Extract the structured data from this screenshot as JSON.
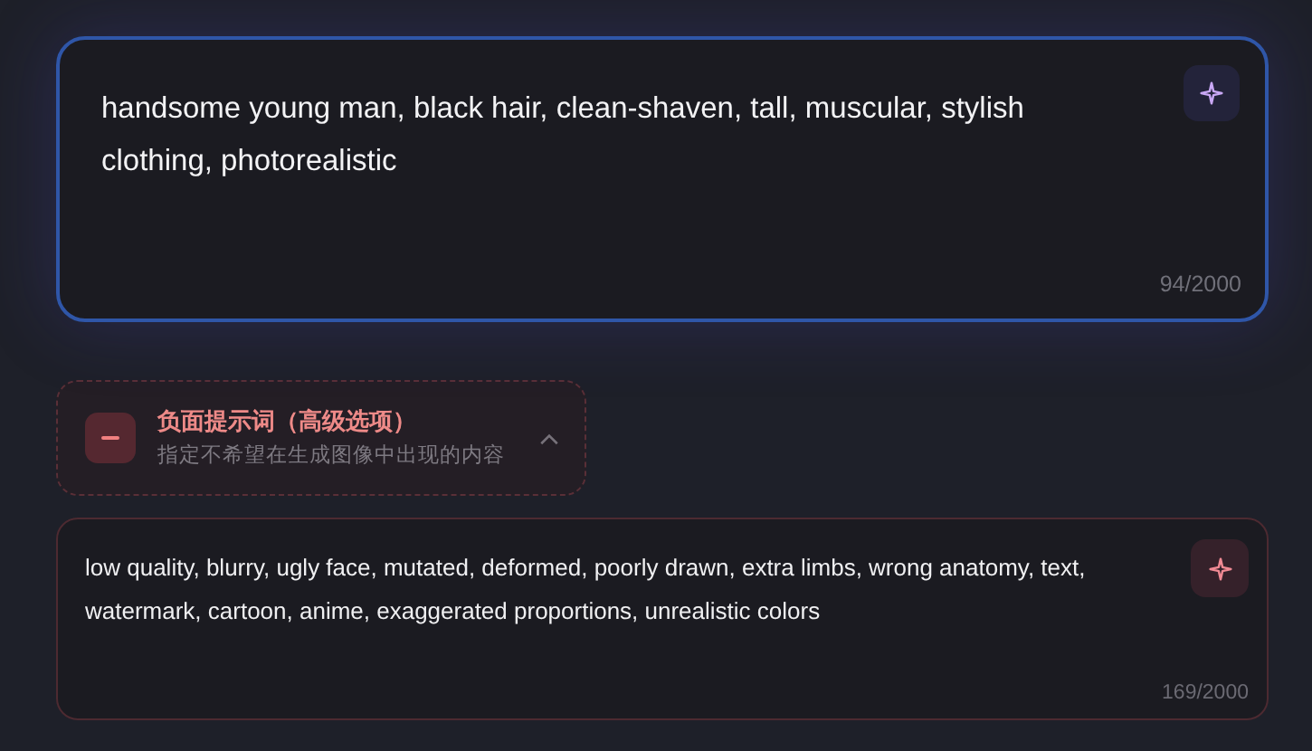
{
  "prompt": {
    "value": "handsome young man, black hair, clean-shaven, tall, muscular, stylish clothing, photorealistic",
    "counter": "94/2000"
  },
  "negative": {
    "title": "负面提示词（高级选项）",
    "subtitle": "指定不希望在生成图像中出现的内容",
    "expanded": true,
    "value": "low quality, blurry, ugly face, mutated, deformed, poorly drawn, extra limbs, wrong anatomy, text, watermark, cartoon, anime, exaggerated proportions, unrealistic colors",
    "counter": "169/2000"
  }
}
